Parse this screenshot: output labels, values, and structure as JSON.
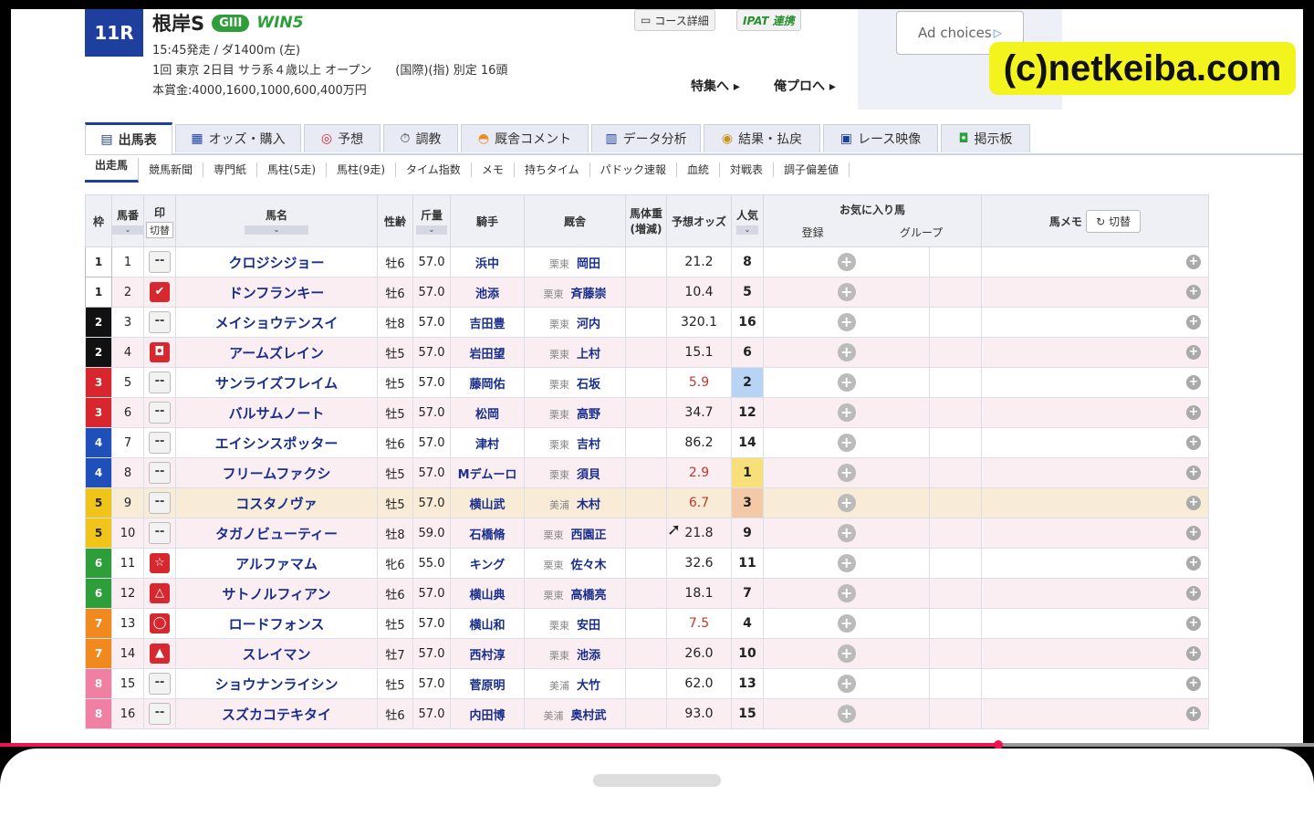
{
  "race": {
    "number": "11R",
    "name": "根岸S",
    "grade": "GIII",
    "win5": "WIN5",
    "line1": "15:45発走 / ダ1400m (左)",
    "line2": "1回 東京 2日目 サラ系４歳以上 オープン　　(国際)(指) 別定 16頭",
    "line3": "本賞金:4000,1600,1000,600,400万円"
  },
  "header_buttons": {
    "course": "コース詳細",
    "ipat": "IPAT 連携",
    "special": "特集へ",
    "pro": "俺プロへ"
  },
  "ad": {
    "label": "Ad choices"
  },
  "watermark": "(c)netkeiba.com",
  "tabs": [
    "出馬表",
    "オッズ・購入",
    "予想",
    "調教",
    "厩舎コメント",
    "データ分析",
    "結果・払戻",
    "レース映像",
    "掲示板"
  ],
  "subtabs": [
    "出走馬",
    "競馬新聞",
    "専門紙",
    "馬柱(5走)",
    "馬柱(9走)",
    "タイム指数",
    "メモ",
    "持ちタイム",
    "パドック速報",
    "血統",
    "対戦表",
    "調子偏差値"
  ],
  "table": {
    "headers": {
      "waku": "枠",
      "umaban": "馬番",
      "mark": "印",
      "mark_toggle": "切替",
      "name": "馬名",
      "sex_age": "性齢",
      "weight": "斤量",
      "jockey": "騎手",
      "trainer": "厩舎",
      "body_weight": "馬体重",
      "body_weight_sub": "(増減)",
      "odds": "予想オッズ",
      "popularity": "人気",
      "favorite": "お気に入り馬",
      "register": "登録",
      "group": "グループ",
      "memo": "馬メモ",
      "memo_toggle": "切替"
    },
    "rows": [
      {
        "waku": "1",
        "umaban": "1",
        "mark": "--",
        "name": "クロジシジョー",
        "sex_age": "牡6",
        "weight": "57.0",
        "jockey": "浜中",
        "aff": "栗東",
        "trainer": "岡田",
        "odds": "21.2",
        "pop": "8"
      },
      {
        "waku": "1",
        "umaban": "2",
        "mark": "✔",
        "name": "ドンフランキー",
        "sex_age": "牡6",
        "weight": "57.0",
        "jockey": "池添",
        "aff": "栗東",
        "trainer": "斉藤崇",
        "odds": "10.4",
        "pop": "5"
      },
      {
        "waku": "2",
        "umaban": "3",
        "mark": "--",
        "name": "メイショウテンスイ",
        "sex_age": "牡8",
        "weight": "57.0",
        "jockey": "吉田豊",
        "aff": "栗東",
        "trainer": "河内",
        "odds": "320.1",
        "pop": "16"
      },
      {
        "waku": "2",
        "umaban": "4",
        "mark": "◘",
        "name": "アームズレイン",
        "sex_age": "牡5",
        "weight": "57.0",
        "jockey": "岩田望",
        "aff": "栗東",
        "trainer": "上村",
        "odds": "15.1",
        "pop": "6"
      },
      {
        "waku": "3",
        "umaban": "5",
        "mark": "--",
        "name": "サンライズフレイム",
        "sex_age": "牡5",
        "weight": "57.0",
        "jockey": "藤岡佑",
        "aff": "栗東",
        "trainer": "石坂",
        "odds": "5.9",
        "pop": "2"
      },
      {
        "waku": "3",
        "umaban": "6",
        "mark": "--",
        "name": "バルサムノート",
        "sex_age": "牡5",
        "weight": "57.0",
        "jockey": "松岡",
        "aff": "栗東",
        "trainer": "高野",
        "odds": "34.7",
        "pop": "12"
      },
      {
        "waku": "4",
        "umaban": "7",
        "mark": "--",
        "name": "エイシンスポッター",
        "sex_age": "牡6",
        "weight": "57.0",
        "jockey": "津村",
        "aff": "栗東",
        "trainer": "吉村",
        "odds": "86.2",
        "pop": "14"
      },
      {
        "waku": "4",
        "umaban": "8",
        "mark": "--",
        "name": "フリームファクシ",
        "sex_age": "牡5",
        "weight": "57.0",
        "jockey": "Mデムーロ",
        "aff": "栗東",
        "trainer": "須貝",
        "odds": "2.9",
        "pop": "1"
      },
      {
        "waku": "5",
        "umaban": "9",
        "mark": "--",
        "name": "コスタノヴァ",
        "sex_age": "牡5",
        "weight": "57.0",
        "jockey": "横山武",
        "aff": "美浦",
        "trainer": "木村",
        "odds": "6.7",
        "pop": "3"
      },
      {
        "waku": "5",
        "umaban": "10",
        "mark": "--",
        "name": "タガノビューティー",
        "sex_age": "牡8",
        "weight": "59.0",
        "jockey": "石橋脩",
        "aff": "栗東",
        "trainer": "西園正",
        "odds": "21.8",
        "pop": "9"
      },
      {
        "waku": "6",
        "umaban": "11",
        "mark": "☆",
        "name": "アルファマム",
        "sex_age": "牝6",
        "weight": "55.0",
        "jockey": "キング",
        "aff": "栗東",
        "trainer": "佐々木",
        "odds": "32.6",
        "pop": "11"
      },
      {
        "waku": "6",
        "umaban": "12",
        "mark": "△",
        "name": "サトノルフィアン",
        "sex_age": "牡6",
        "weight": "57.0",
        "jockey": "横山典",
        "aff": "栗東",
        "trainer": "高橋亮",
        "odds": "18.1",
        "pop": "7"
      },
      {
        "waku": "7",
        "umaban": "13",
        "mark": "◯",
        "name": "ロードフォンス",
        "sex_age": "牡5",
        "weight": "57.0",
        "jockey": "横山和",
        "aff": "栗東",
        "trainer": "安田",
        "odds": "7.5",
        "pop": "4"
      },
      {
        "waku": "7",
        "umaban": "14",
        "mark": "▲",
        "name": "スレイマン",
        "sex_age": "牡7",
        "weight": "57.0",
        "jockey": "西村淳",
        "aff": "栗東",
        "trainer": "池添",
        "odds": "26.0",
        "pop": "10"
      },
      {
        "waku": "8",
        "umaban": "15",
        "mark": "--",
        "name": "ショウナンライシン",
        "sex_age": "牡5",
        "weight": "57.0",
        "jockey": "菅原明",
        "aff": "美浦",
        "trainer": "大竹",
        "odds": "62.0",
        "pop": "13"
      },
      {
        "waku": "8",
        "umaban": "16",
        "mark": "--",
        "name": "スズカコテキタイ",
        "sex_age": "牡6",
        "weight": "57.0",
        "jockey": "内田博",
        "aff": "美浦",
        "trainer": "奥村武",
        "odds": "93.0",
        "pop": "15"
      }
    ]
  },
  "colors": {
    "waku": {
      "1": "#ffffff",
      "2": "#111111",
      "3": "#d7262e",
      "4": "#1f4fb8",
      "5": "#f0c419",
      "6": "#2e9e3a",
      "7": "#f08a1e",
      "8": "#f07fa4"
    },
    "accent": "#1e3f9e",
    "progress": "#f0134f"
  },
  "video": {
    "progress": 0.76
  }
}
